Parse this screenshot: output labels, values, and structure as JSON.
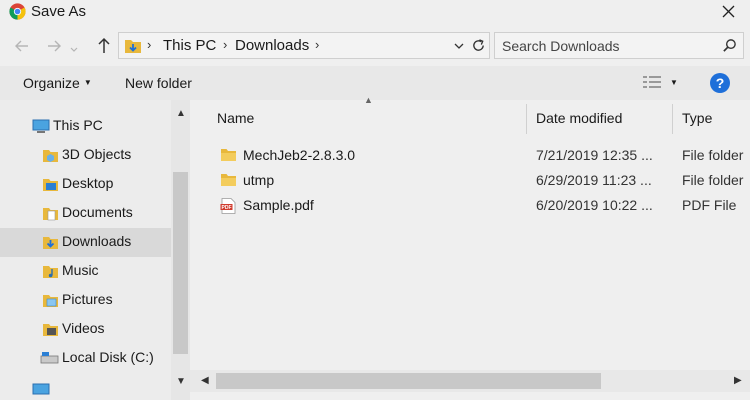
{
  "window": {
    "title": "Save As"
  },
  "address": {
    "crumbs": [
      "This PC",
      "Downloads"
    ]
  },
  "search": {
    "placeholder": "Search Downloads"
  },
  "toolbar": {
    "organize": "Organize",
    "new_folder": "New folder"
  },
  "nav": {
    "items": [
      {
        "label": "This PC",
        "icon": "computer-icon"
      },
      {
        "label": "3D Objects",
        "icon": "3d-objects-folder-icon"
      },
      {
        "label": "Desktop",
        "icon": "desktop-folder-icon"
      },
      {
        "label": "Documents",
        "icon": "documents-folder-icon"
      },
      {
        "label": "Downloads",
        "icon": "downloads-folder-icon",
        "selected": true
      },
      {
        "label": "Music",
        "icon": "music-folder-icon"
      },
      {
        "label": "Pictures",
        "icon": "pictures-folder-icon"
      },
      {
        "label": "Videos",
        "icon": "videos-folder-icon"
      },
      {
        "label": "Local Disk (C:)",
        "icon": "drive-icon"
      }
    ]
  },
  "columns": {
    "name": "Name",
    "date": "Date modified",
    "type": "Type"
  },
  "files": [
    {
      "name": "MechJeb2-2.8.3.0",
      "date": "7/21/2019 12:35 ...",
      "type": "File folder",
      "icon": "folder-icon"
    },
    {
      "name": "utmp",
      "date": "6/29/2019 11:23 ...",
      "type": "File folder",
      "icon": "folder-icon"
    },
    {
      "name": "Sample.pdf",
      "date": "6/20/2019 10:22 ...",
      "type": "PDF File",
      "icon": "pdf-file-icon"
    }
  ],
  "colors": {
    "accent": "#1e6fd9",
    "folder": "#e8b83c",
    "selected": "#d9d9d9"
  }
}
